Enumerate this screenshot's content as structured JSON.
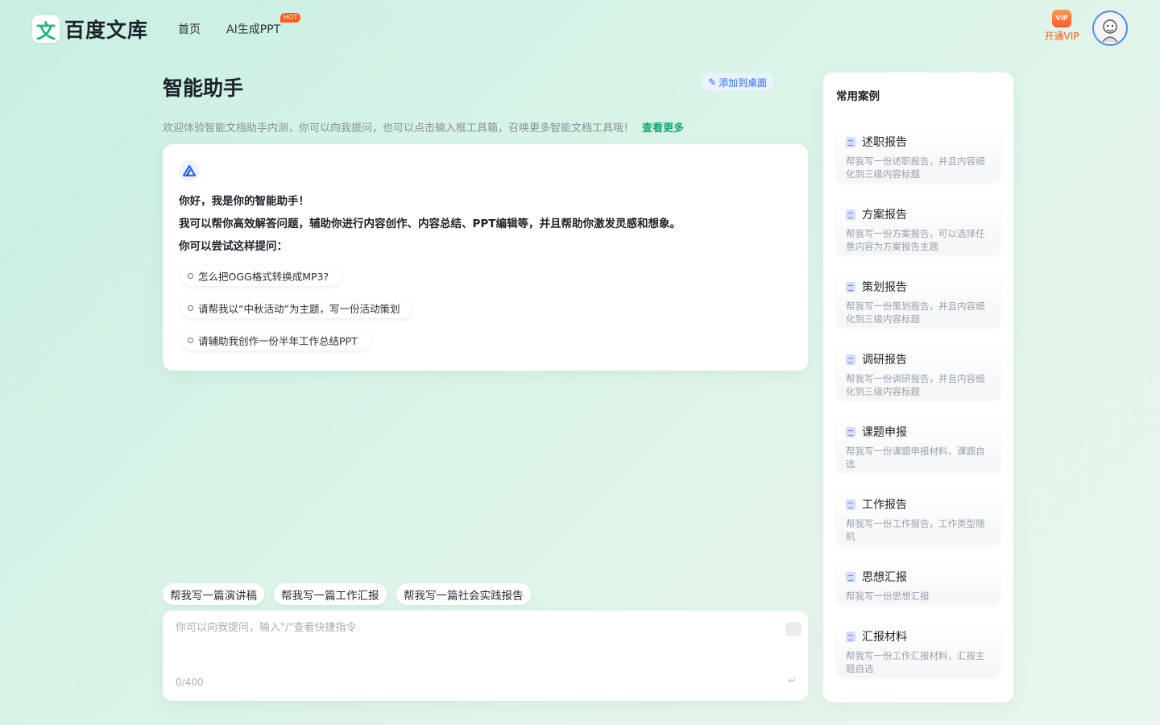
{
  "header": {
    "logo_mark": "文",
    "logo_text": "百度文库",
    "nav": [
      {
        "label": "首页"
      },
      {
        "label": "AI生成PPT",
        "badge": "HOT"
      }
    ],
    "vip_icon_text": "VIP",
    "vip_label": "开通VIP"
  },
  "main": {
    "title": "智能助手",
    "pin_label": "添加到桌面",
    "intro": "欢迎体验智能文档助手内测，你可以向我提问，也可以点击输入框工具箱，召唤更多智能文档工具哦！",
    "intro_link": "查看更多",
    "greeting": [
      "你好，我是你的智能助手！",
      "我可以帮你高效解答问题，辅助你进行内容创作、内容总结、PPT编辑等，并且帮助你激发灵感和想象。",
      "你可以尝试这样提问："
    ],
    "suggestions": [
      "怎么把OGG格式转换成MP3?",
      "请帮我以“中秋活动”为主题，写一份活动策划",
      "请辅助我创作一份半年工作总结PPT"
    ],
    "quick_chips": [
      "帮我写一篇演讲稿",
      "帮我写一篇工作汇报",
      "帮我写一篇社会实践报告"
    ],
    "input": {
      "placeholder": "你可以向我提问，输入\"/\"查看快捷指令",
      "value": "",
      "counter": "0/400"
    }
  },
  "side": {
    "title": "常用案例",
    "cases": [
      {
        "name": "述职报告",
        "desc": "帮我写一份述职报告，并且内容细化到三级内容标题"
      },
      {
        "name": "方案报告",
        "desc": "帮我写一份方案报告，可以选择任意内容为方案报告主题"
      },
      {
        "name": "策划报告",
        "desc": "帮我写一份策划报告，并且内容细化到三级内容标题"
      },
      {
        "name": "调研报告",
        "desc": "帮我写一份调研报告，并且内容细化到三级内容标题"
      },
      {
        "name": "课题申报",
        "desc": "帮我写一份课题申报材料，课题自选"
      },
      {
        "name": "工作报告",
        "desc": "帮我写一份工作报告，工作类型随机"
      },
      {
        "name": "思想汇报",
        "desc": "帮我写一份思想汇报"
      },
      {
        "name": "汇报材料",
        "desc": "帮我写一份工作汇报材料，汇报主题自选"
      }
    ]
  },
  "colors": {
    "accent_green": "#13a87a",
    "vip_orange": "#ff5b1a",
    "link_blue": "#2f6bff"
  }
}
